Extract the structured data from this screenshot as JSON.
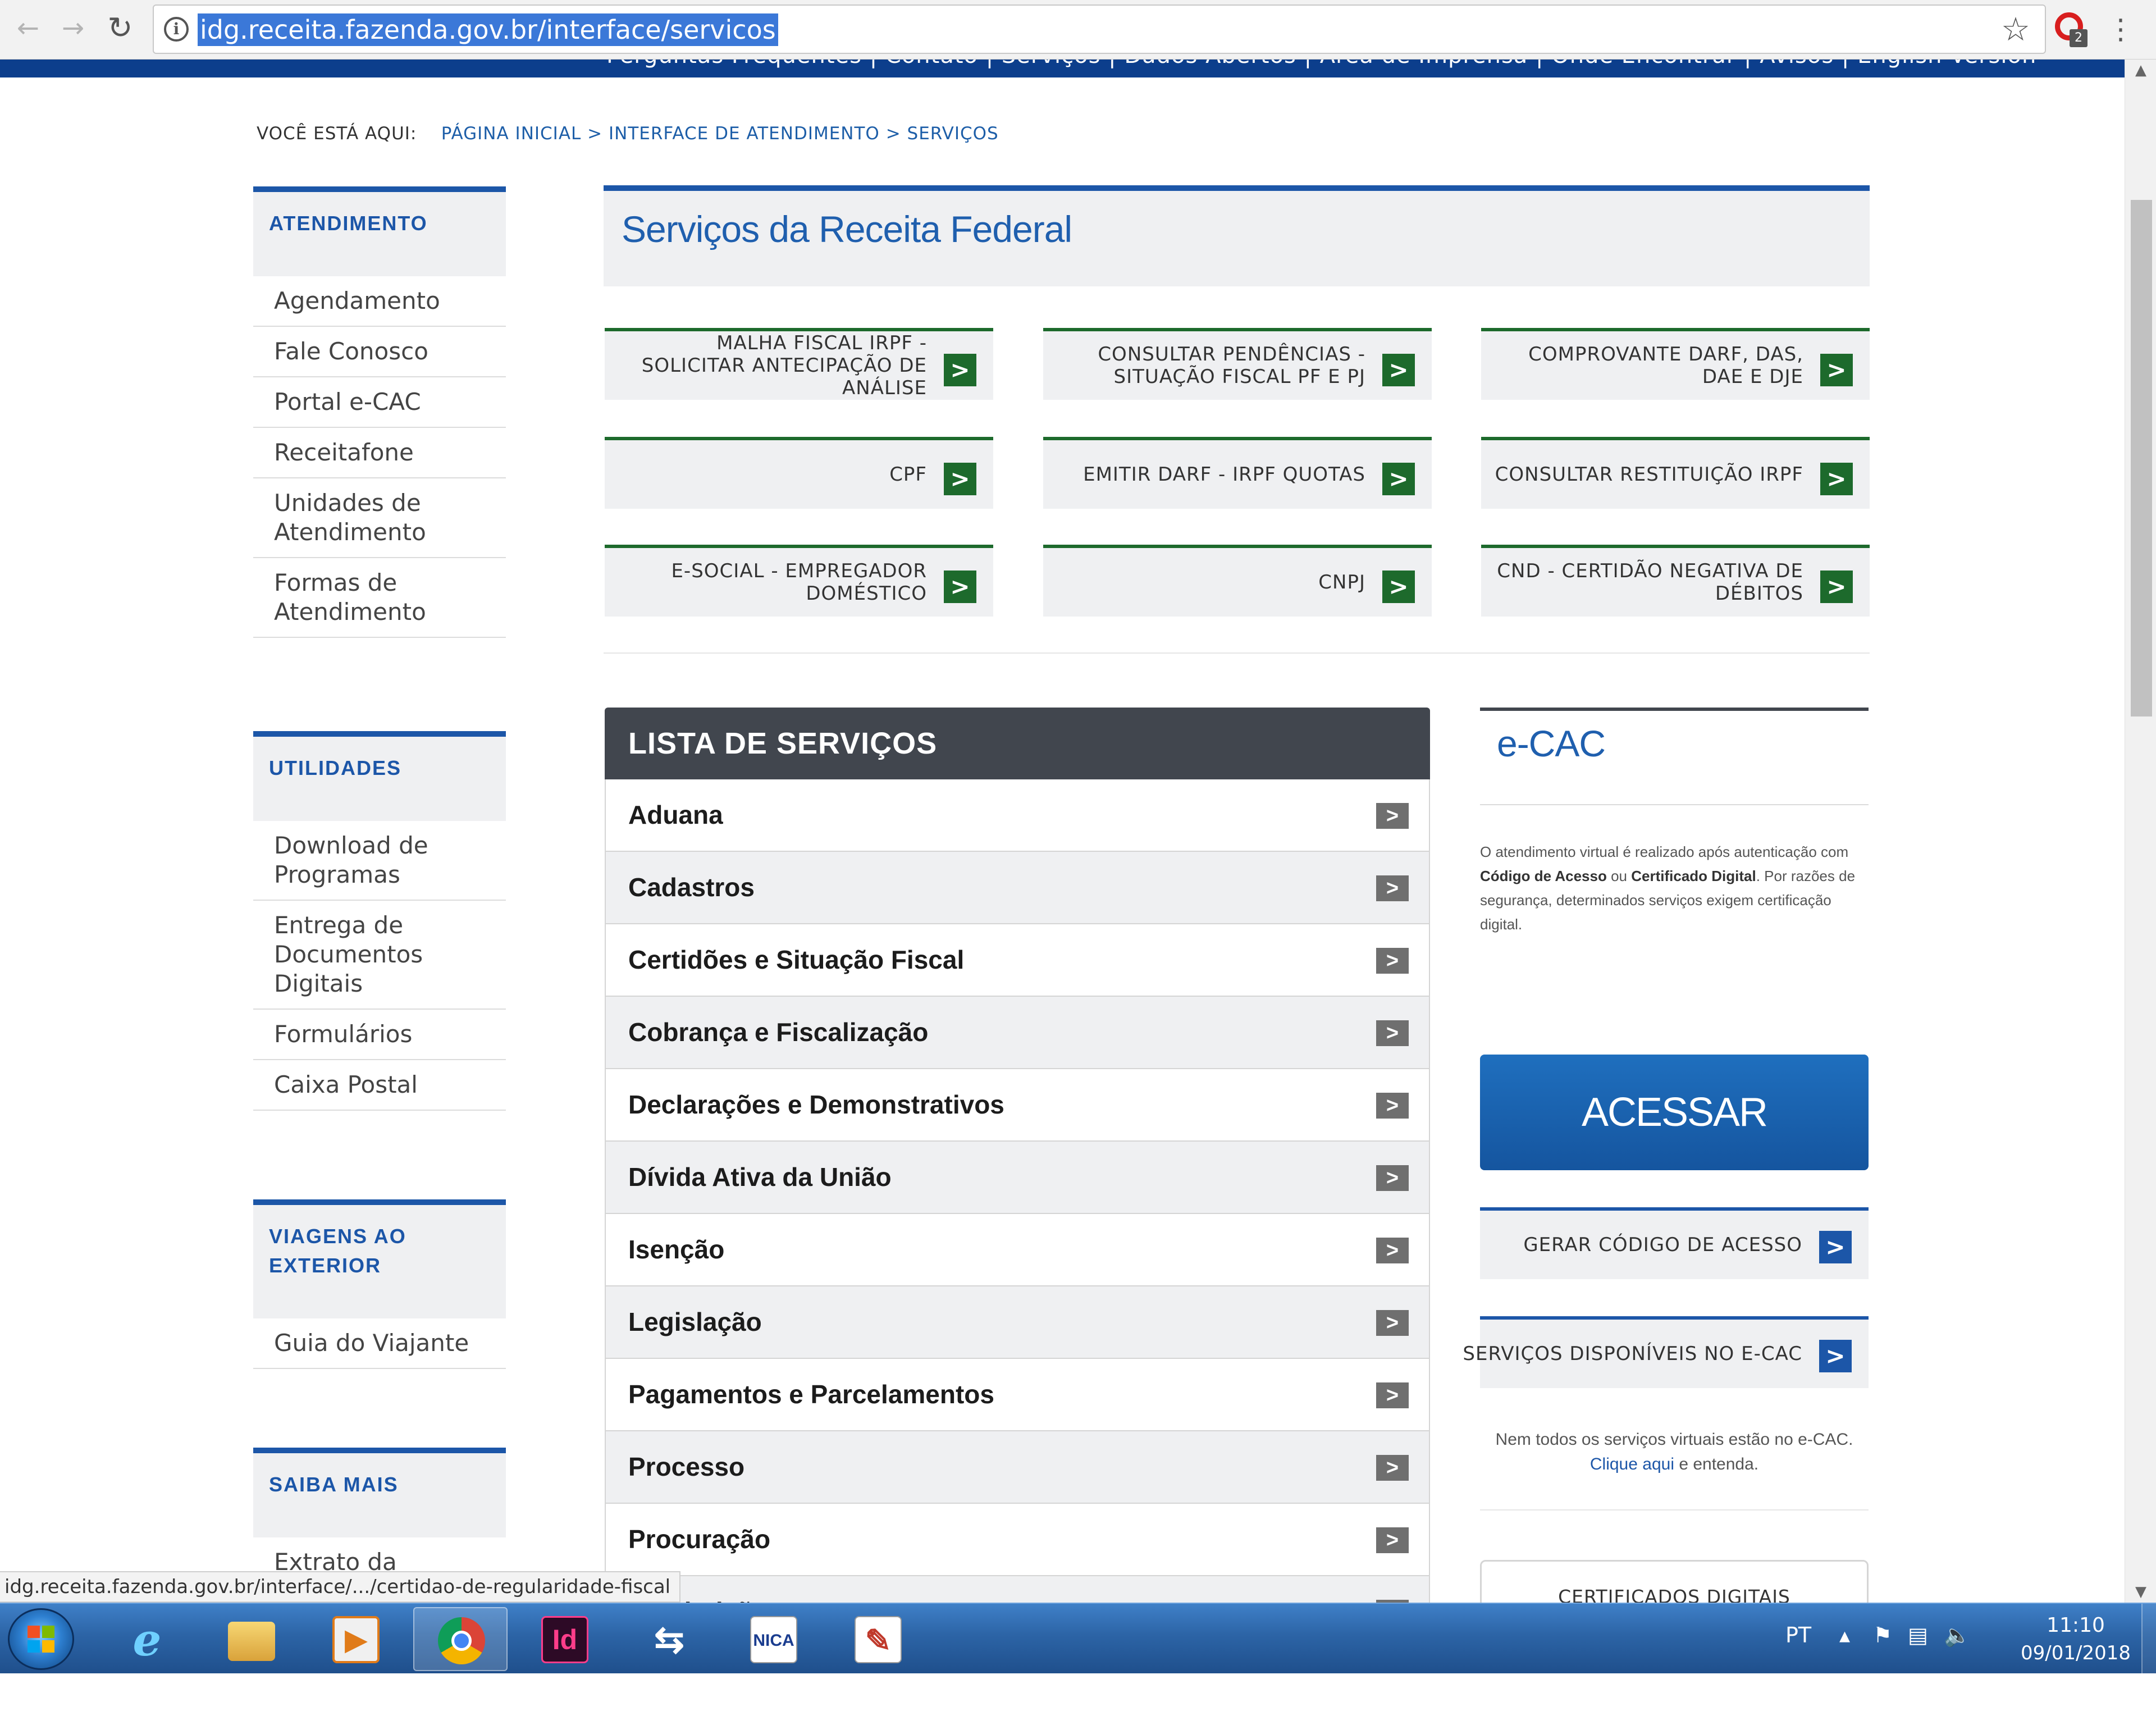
{
  "browser": {
    "url": "idg.receita.fazenda.gov.br/interface/servicos",
    "extension_badge": "2",
    "status_url": "idg.receita.fazenda.gov.br/interface/.../certidao-de-regularidade-fiscal"
  },
  "site_nav": {
    "links_text": "Perguntas Frequentes  |  Contato  |  Serviços  |  Dados Abertos  |  Área de Imprensa  |  Onde Encontrar  |  Avisos  |  English Version"
  },
  "breadcrumb": {
    "here": "VOCÊ ESTÁ AQUI:",
    "items": [
      "PÁGINA INICIAL",
      "INTERFACE DE ATENDIMENTO",
      "SERVIÇOS"
    ],
    "separator": ">"
  },
  "sidebar": {
    "sections": [
      {
        "title": "ATENDIMENTO",
        "items": [
          "Agendamento",
          "Fale Conosco",
          "Portal e-CAC",
          "Receitafone",
          "Unidades de Atendimento",
          "Formas de Atendimento"
        ]
      },
      {
        "title": "UTILIDADES",
        "items": [
          "Download de Programas",
          "Entrega de Documentos Digitais",
          "Formulários",
          "Caixa Postal"
        ]
      },
      {
        "title": "VIAGENS AO EXTERIOR",
        "items": [
          "Guia do Viajante"
        ]
      },
      {
        "title": "SAIBA MAIS",
        "items": [
          "Extrato da"
        ]
      }
    ]
  },
  "main": {
    "title": "Serviços da Receita Federal",
    "quick_links": [
      "MALHA FISCAL IRPF - SOLICITAR ANTECIPAÇÃO DE ANÁLISE",
      "CONSULTAR PENDÊNCIAS - SITUAÇÃO FISCAL PF E PJ",
      "COMPROVANTE DARF, DAS, DAE E DJE",
      "CPF",
      "EMITIR DARF - IRPF QUOTAS",
      "CONSULTAR RESTITUIÇÃO IRPF",
      "E-SOCIAL - EMPREGADOR DOMÉSTICO",
      "CNPJ",
      "CND - CERTIDÃO NEGATIVA DE DÉBITOS"
    ],
    "quick_arrow": ">",
    "services_title": "LISTA DE SERVIÇOS",
    "services": [
      "Aduana",
      "Cadastros",
      "Certidões e Situação Fiscal",
      "Cobrança e Fiscalização",
      "Declarações e Demonstrativos",
      "Dívida Ativa da União",
      "Isenção",
      "Legislação",
      "Pagamentos e Parcelamentos",
      "Processo",
      "Procuração",
      "Restituição"
    ],
    "service_arrow": ">"
  },
  "ecac": {
    "title": "e-CAC",
    "desc_1": "O atendimento virtual é realizado após autenticação com ",
    "desc_bold_1": "Código de Acesso",
    "desc_2": " ou ",
    "desc_bold_2": "Certificado Digital",
    "desc_3": ". Por razões de segurança, determinados serviços exigem certificação digital.",
    "access_button": "ACESSAR",
    "generate_code": "GERAR CÓDIGO DE ACESSO",
    "services_available": "SERVIÇOS DISPONÍVEIS NO E-CAC",
    "note_1": "Nem todos os serviços virtuais estão no e-CAC.",
    "note_link": "Clique aqui",
    "note_2": " e entenda.",
    "certificates_button": "CERTIFICADOS DIGITAIS"
  },
  "taskbar": {
    "apps": [
      "start-button",
      "internet-explorer",
      "file-explorer",
      "media-player",
      "chrome",
      "indesign",
      "network-transfer",
      "unica-app",
      "paint-app"
    ],
    "indesign_label": "Id",
    "unica_label": "NICA",
    "tray_lang": "PT",
    "time": "11:10",
    "date": "09/01/2018"
  },
  "colors": {
    "brand_blue": "#1c56a8",
    "dark_blue_nav": "#0c3e8c",
    "green_arrow": "#1d6a2c",
    "list_header": "#41464e",
    "acessar_blue": "#1a5ba7"
  }
}
